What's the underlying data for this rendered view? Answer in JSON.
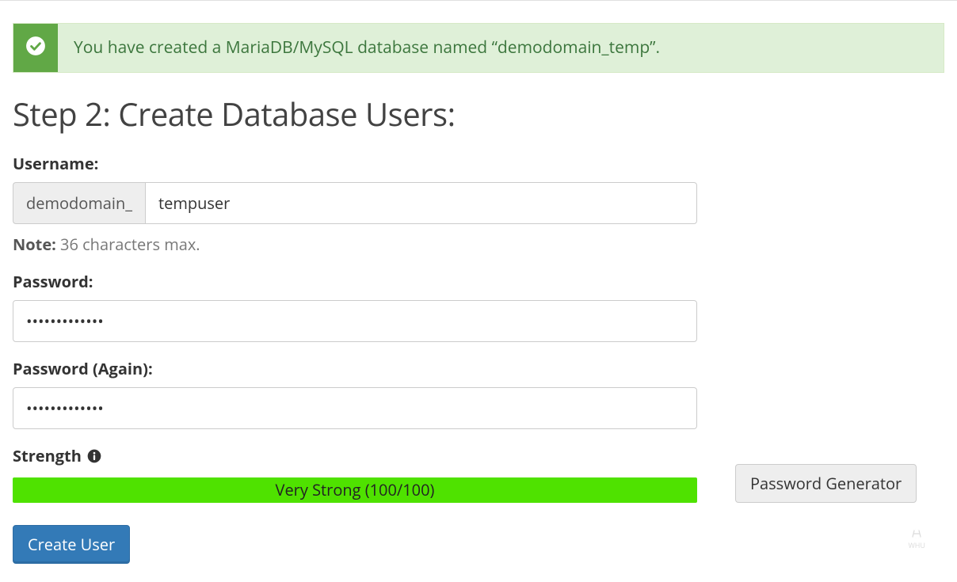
{
  "alert": {
    "message": "You have created a MariaDB/MySQL database named “demodomain_temp”."
  },
  "heading": "Step 2: Create Database Users:",
  "username": {
    "label": "Username:",
    "prefix": "demodomain_",
    "value": "tempuser",
    "note_label": "Note:",
    "note_text": " 36 characters max."
  },
  "password": {
    "label": "Password:",
    "value": "•••••••••••••"
  },
  "password_again": {
    "label": "Password (Again):",
    "value": "•••••••••••••"
  },
  "strength": {
    "label": "Strength",
    "bar_text": "Very Strong (100/100)"
  },
  "buttons": {
    "password_generator": "Password Generator",
    "create_user": "Create User"
  },
  "watermark": "WHU"
}
